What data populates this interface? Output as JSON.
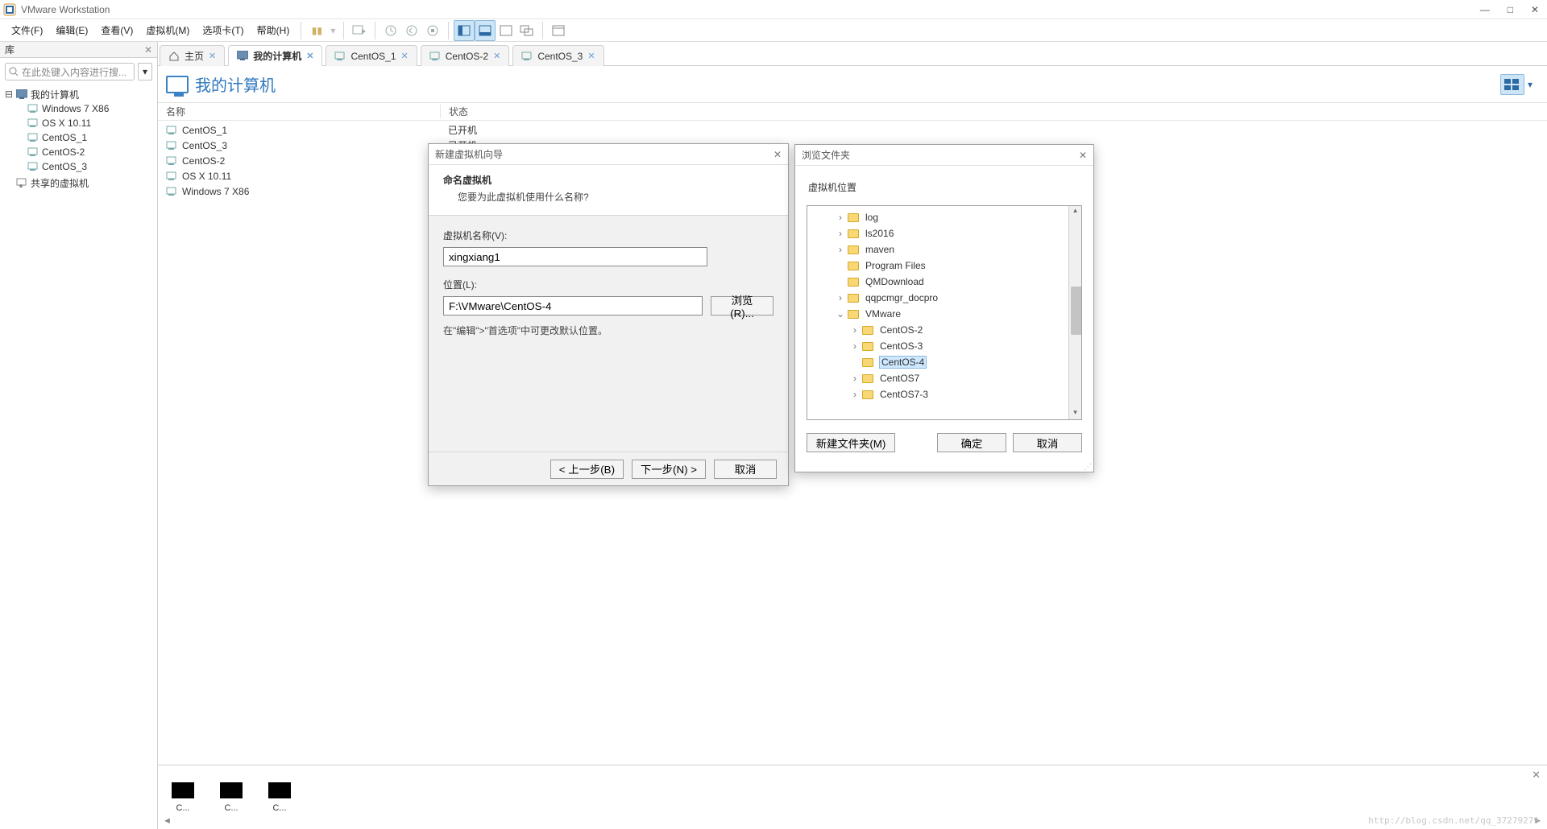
{
  "app": {
    "title": "VMware Workstation"
  },
  "menu": {
    "file": "文件(F)",
    "edit": "编辑(E)",
    "view": "查看(V)",
    "vm": "虚拟机(M)",
    "tabs": "选项卡(T)",
    "help": "帮助(H)"
  },
  "sidebar": {
    "header": "库",
    "search_placeholder": "在此处键入内容进行搜...",
    "root": "我的计算机",
    "items": [
      "Windows 7 X86",
      "OS X 10.11",
      "CentOS_1",
      "CentOS-2",
      "CentOS_3"
    ],
    "shared": "共享的虚拟机"
  },
  "tabs": {
    "home": "主页",
    "active": "我的计算机",
    "others": [
      "CentOS_1",
      "CentOS-2",
      "CentOS_3"
    ]
  },
  "page": {
    "title": "我的计算机"
  },
  "columns": {
    "name": "名称",
    "status": "状态"
  },
  "vm_list": [
    {
      "name": "CentOS_1",
      "status": "已开机"
    },
    {
      "name": "CentOS_3",
      "status": "已开机"
    },
    {
      "name": "CentOS-2",
      "status": ""
    },
    {
      "name": "OS X 10.11",
      "status": ""
    },
    {
      "name": "Windows 7 X86",
      "status": ""
    }
  ],
  "thumbs": [
    "C...",
    "C...",
    "C..."
  ],
  "wizard": {
    "title": "新建虚拟机向导",
    "banner_title": "命名虚拟机",
    "banner_sub": "您要为此虚拟机使用什么名称?",
    "name_label": "虚拟机名称(V):",
    "name_value": "xingxiang1",
    "loc_label": "位置(L):",
    "loc_value": "F:\\VMware\\CentOS-4",
    "browse_btn": "浏览(R)...",
    "hint": "在\"编辑\">\"首选项\"中可更改默认位置。",
    "back_btn": "< 上一步(B)",
    "next_btn": "下一步(N) >",
    "cancel_btn": "取消"
  },
  "browse": {
    "title": "浏览文件夹",
    "heading": "虚拟机位置",
    "tree": [
      {
        "indent": 1,
        "expand": ">",
        "name": "log"
      },
      {
        "indent": 1,
        "expand": ">",
        "name": "ls2016"
      },
      {
        "indent": 1,
        "expand": ">",
        "name": "maven"
      },
      {
        "indent": 1,
        "expand": "",
        "name": "Program Files"
      },
      {
        "indent": 1,
        "expand": "",
        "name": "QMDownload"
      },
      {
        "indent": 1,
        "expand": ">",
        "name": "qqpcmgr_docpro"
      },
      {
        "indent": 1,
        "expand": "v",
        "name": "VMware"
      },
      {
        "indent": 2,
        "expand": ">",
        "name": "CentOS-2"
      },
      {
        "indent": 2,
        "expand": ">",
        "name": "CentOS-3"
      },
      {
        "indent": 2,
        "expand": "",
        "name": "CentOS-4",
        "selected": true
      },
      {
        "indent": 2,
        "expand": ">",
        "name": "CentOS7"
      },
      {
        "indent": 2,
        "expand": ">",
        "name": "CentOS7-3"
      }
    ],
    "new_folder_btn": "新建文件夹(M)",
    "ok_btn": "确定",
    "cancel_btn": "取消"
  },
  "watermark": "http://blog.csdn.net/qq_37279279"
}
